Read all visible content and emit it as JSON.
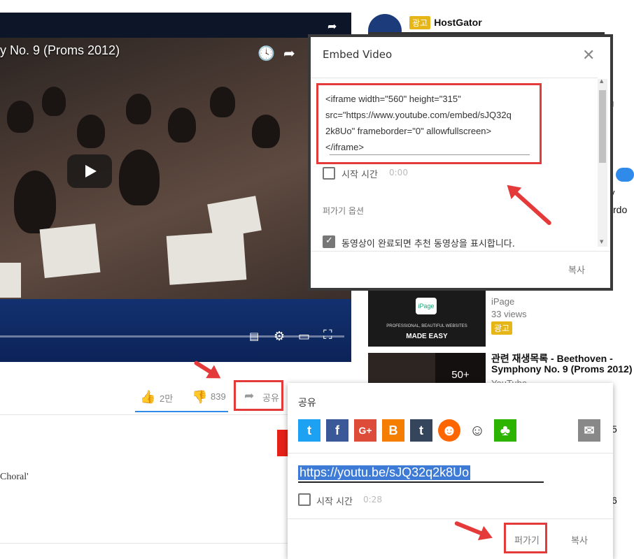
{
  "video": {
    "title": "y No. 9 (Proms 2012)"
  },
  "sidebar": {
    "ad_top": {
      "badge": "광고",
      "advertiser": "HostGator"
    },
    "ad_ipage": {
      "channel": "iPage",
      "views": "33 views",
      "badge": "광고",
      "banner_line1": "PROFESSIONAL, BEAUTIFUL WEBSITES",
      "banner_line2": "MADE EASY",
      "logo": "iPage"
    },
    "playlist": {
      "title_line1": "관련 재생목록 - Beethoven -",
      "title_line2": "Symphony No. 9 (Proms 2012)",
      "count": "50+",
      "channel": "YouTube"
    },
    "fragments": {
      "g": "g",
      "y": "y",
      "rdo": "rdo",
      "n5": "5",
      "n6": "6"
    }
  },
  "actions": {
    "like_count": "2만",
    "dislike_count": "839",
    "share_label": "공유"
  },
  "description": {
    "choral": "Choral'"
  },
  "embed_dialog": {
    "title": "Embed Video",
    "code_lines": [
      "<iframe width=\"560\" height=\"315\"",
      "src=\"https://www.youtube.com/embed/sJQ32q",
      "2k8Uo\" frameborder=\"0\" allowfullscreen>",
      "</iframe>"
    ],
    "start_time_label": "시작 시간",
    "start_time_value": "0:00",
    "options_heading": "퍼가기 옵션",
    "suggest_label": "동영상이 완료되면 추천 동영상을 표시합니다.",
    "copy_label": "복사"
  },
  "share_panel": {
    "title": "공유",
    "networks": [
      {
        "name": "twitter",
        "glyph": "t",
        "color": "#1da1f2"
      },
      {
        "name": "facebook",
        "glyph": "f",
        "color": "#3b5998"
      },
      {
        "name": "google-plus",
        "glyph": "G+",
        "color": "#dd4b39"
      },
      {
        "name": "blogger",
        "glyph": "B",
        "color": "#f57d00"
      },
      {
        "name": "tumblr",
        "glyph": "t",
        "color": "#35465c"
      },
      {
        "name": "kakao",
        "glyph": "☻",
        "color": "#ff6600"
      },
      {
        "name": "reddit",
        "glyph": "☺",
        "color": "#ffffff"
      },
      {
        "name": "cafe",
        "glyph": "♣",
        "color": "#2db400"
      }
    ],
    "url": "https://youtu.be/sJQ32q2k8Uo",
    "start_time_label": "시작 시간",
    "start_time_value": "0:28",
    "embed_button": "퍼가기",
    "copy_button": "복사"
  },
  "colors": {
    "highlight": "#e53a3a",
    "ad_badge": "#e6b619",
    "toggle": "#2f8ae9"
  }
}
